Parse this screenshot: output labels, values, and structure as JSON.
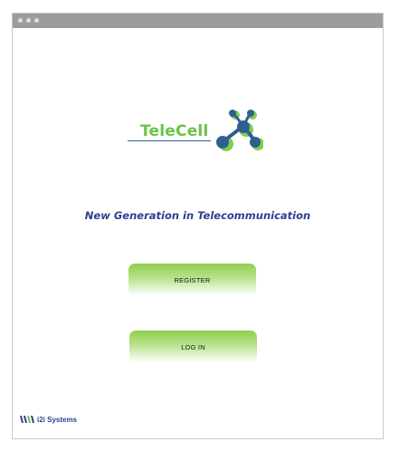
{
  "window": {
    "titlebar_dots": 3
  },
  "logo": {
    "text": "TeleCell",
    "icon": "network-x-icon",
    "colors": {
      "green": "#6cc24a",
      "blue": "#2f5f8f"
    }
  },
  "tagline": "New Generation in Telecommunication",
  "buttons": {
    "register_label": "REGİSTER",
    "login_label": "LOG IN"
  },
  "footer": {
    "brand_text": "i2i Systems",
    "icon": "i2i-logo-icon"
  },
  "colors": {
    "button_green": "#8fcf4f",
    "tagline_blue": "#2e3f8f"
  }
}
